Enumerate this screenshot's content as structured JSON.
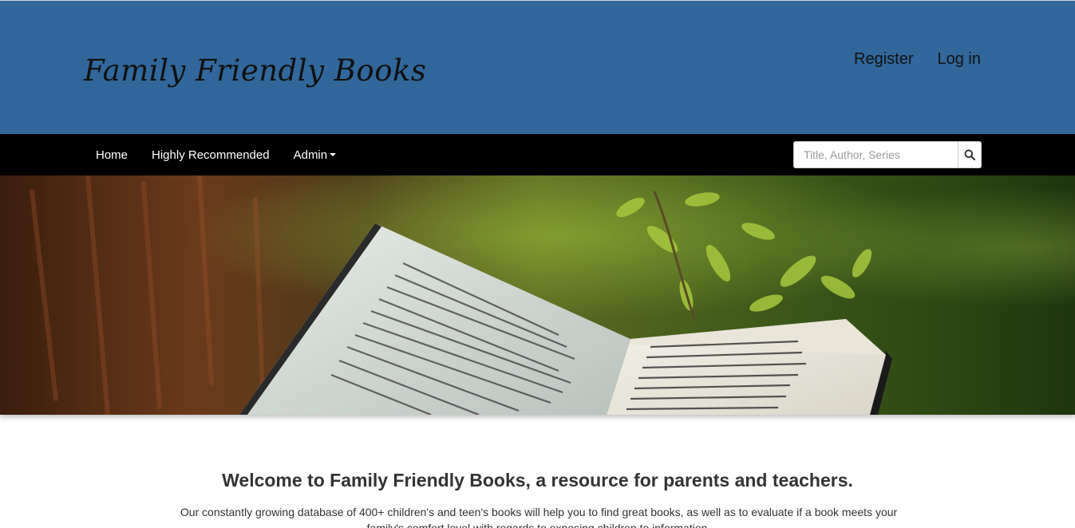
{
  "header": {
    "site_title": "Family Friendly Books",
    "register_label": "Register",
    "login_label": "Log in",
    "background_color": "#31679b"
  },
  "nav": {
    "items": [
      {
        "label": "Home"
      },
      {
        "label": "Highly Recommended"
      },
      {
        "label": "Admin"
      }
    ],
    "search": {
      "placeholder": "Title, Author, Series",
      "value": "",
      "button_icon": "search-icon"
    }
  },
  "hero": {
    "image_alt": "Open book resting on a tree branch outdoors"
  },
  "main": {
    "welcome_heading": "Welcome to Family Friendly Books, a resource for parents and teachers.",
    "intro_text": "Our constantly growing database of 400+ children's and teen's books will help you to find great books, as well as to evaluate if a book meets your family's comfort level with regards to exposing children to information."
  }
}
